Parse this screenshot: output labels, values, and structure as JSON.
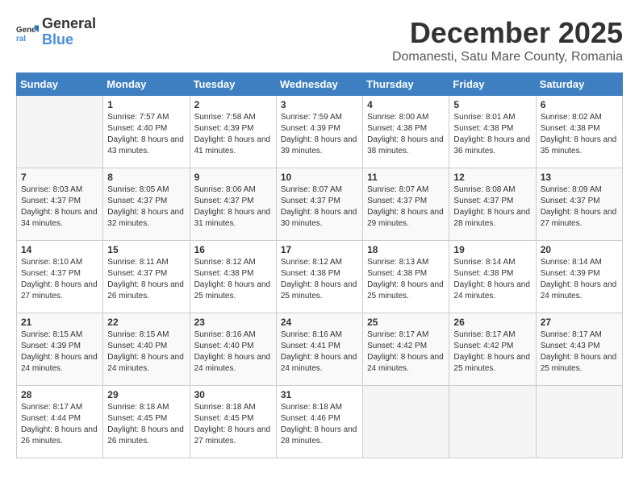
{
  "header": {
    "logo_general": "General",
    "logo_blue": "Blue",
    "month_year": "December 2025",
    "location": "Domanesti, Satu Mare County, Romania"
  },
  "days_of_week": [
    "Sunday",
    "Monday",
    "Tuesday",
    "Wednesday",
    "Thursday",
    "Friday",
    "Saturday"
  ],
  "weeks": [
    [
      {
        "day": "",
        "info": ""
      },
      {
        "day": "1",
        "sunrise": "7:57 AM",
        "sunset": "4:40 PM",
        "daylight": "8 hours and 43 minutes."
      },
      {
        "day": "2",
        "sunrise": "7:58 AM",
        "sunset": "4:39 PM",
        "daylight": "8 hours and 41 minutes."
      },
      {
        "day": "3",
        "sunrise": "7:59 AM",
        "sunset": "4:39 PM",
        "daylight": "8 hours and 39 minutes."
      },
      {
        "day": "4",
        "sunrise": "8:00 AM",
        "sunset": "4:38 PM",
        "daylight": "8 hours and 38 minutes."
      },
      {
        "day": "5",
        "sunrise": "8:01 AM",
        "sunset": "4:38 PM",
        "daylight": "8 hours and 36 minutes."
      },
      {
        "day": "6",
        "sunrise": "8:02 AM",
        "sunset": "4:38 PM",
        "daylight": "8 hours and 35 minutes."
      }
    ],
    [
      {
        "day": "7",
        "sunrise": "8:03 AM",
        "sunset": "4:37 PM",
        "daylight": "8 hours and 34 minutes."
      },
      {
        "day": "8",
        "sunrise": "8:05 AM",
        "sunset": "4:37 PM",
        "daylight": "8 hours and 32 minutes."
      },
      {
        "day": "9",
        "sunrise": "8:06 AM",
        "sunset": "4:37 PM",
        "daylight": "8 hours and 31 minutes."
      },
      {
        "day": "10",
        "sunrise": "8:07 AM",
        "sunset": "4:37 PM",
        "daylight": "8 hours and 30 minutes."
      },
      {
        "day": "11",
        "sunrise": "8:07 AM",
        "sunset": "4:37 PM",
        "daylight": "8 hours and 29 minutes."
      },
      {
        "day": "12",
        "sunrise": "8:08 AM",
        "sunset": "4:37 PM",
        "daylight": "8 hours and 28 minutes."
      },
      {
        "day": "13",
        "sunrise": "8:09 AM",
        "sunset": "4:37 PM",
        "daylight": "8 hours and 27 minutes."
      }
    ],
    [
      {
        "day": "14",
        "sunrise": "8:10 AM",
        "sunset": "4:37 PM",
        "daylight": "8 hours and 27 minutes."
      },
      {
        "day": "15",
        "sunrise": "8:11 AM",
        "sunset": "4:37 PM",
        "daylight": "8 hours and 26 minutes."
      },
      {
        "day": "16",
        "sunrise": "8:12 AM",
        "sunset": "4:38 PM",
        "daylight": "8 hours and 25 minutes."
      },
      {
        "day": "17",
        "sunrise": "8:12 AM",
        "sunset": "4:38 PM",
        "daylight": "8 hours and 25 minutes."
      },
      {
        "day": "18",
        "sunrise": "8:13 AM",
        "sunset": "4:38 PM",
        "daylight": "8 hours and 25 minutes."
      },
      {
        "day": "19",
        "sunrise": "8:14 AM",
        "sunset": "4:38 PM",
        "daylight": "8 hours and 24 minutes."
      },
      {
        "day": "20",
        "sunrise": "8:14 AM",
        "sunset": "4:39 PM",
        "daylight": "8 hours and 24 minutes."
      }
    ],
    [
      {
        "day": "21",
        "sunrise": "8:15 AM",
        "sunset": "4:39 PM",
        "daylight": "8 hours and 24 minutes."
      },
      {
        "day": "22",
        "sunrise": "8:15 AM",
        "sunset": "4:40 PM",
        "daylight": "8 hours and 24 minutes."
      },
      {
        "day": "23",
        "sunrise": "8:16 AM",
        "sunset": "4:40 PM",
        "daylight": "8 hours and 24 minutes."
      },
      {
        "day": "24",
        "sunrise": "8:16 AM",
        "sunset": "4:41 PM",
        "daylight": "8 hours and 24 minutes."
      },
      {
        "day": "25",
        "sunrise": "8:17 AM",
        "sunset": "4:42 PM",
        "daylight": "8 hours and 24 minutes."
      },
      {
        "day": "26",
        "sunrise": "8:17 AM",
        "sunset": "4:42 PM",
        "daylight": "8 hours and 25 minutes."
      },
      {
        "day": "27",
        "sunrise": "8:17 AM",
        "sunset": "4:43 PM",
        "daylight": "8 hours and 25 minutes."
      }
    ],
    [
      {
        "day": "28",
        "sunrise": "8:17 AM",
        "sunset": "4:44 PM",
        "daylight": "8 hours and 26 minutes."
      },
      {
        "day": "29",
        "sunrise": "8:18 AM",
        "sunset": "4:45 PM",
        "daylight": "8 hours and 26 minutes."
      },
      {
        "day": "30",
        "sunrise": "8:18 AM",
        "sunset": "4:45 PM",
        "daylight": "8 hours and 27 minutes."
      },
      {
        "day": "31",
        "sunrise": "8:18 AM",
        "sunset": "4:46 PM",
        "daylight": "8 hours and 28 minutes."
      },
      {
        "day": "",
        "info": ""
      },
      {
        "day": "",
        "info": ""
      },
      {
        "day": "",
        "info": ""
      }
    ]
  ]
}
